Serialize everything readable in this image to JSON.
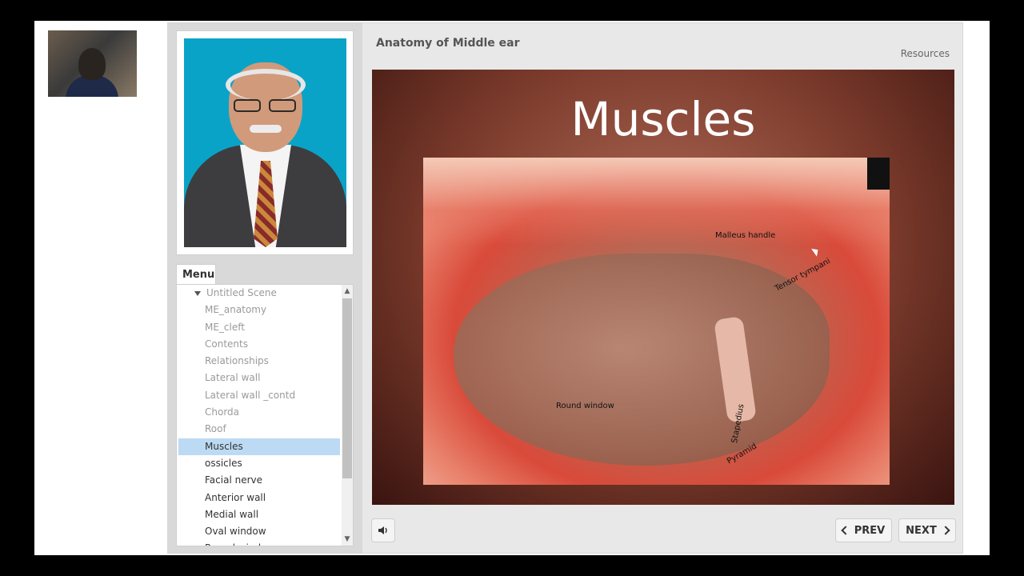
{
  "lesson": {
    "title": "Anatomy of Middle ear",
    "resources_label": "Resources"
  },
  "menu": {
    "tab_label": "Menu",
    "scene_label": "Untitled Scene",
    "items": [
      {
        "label": "ME_anatomy",
        "state": "visited"
      },
      {
        "label": "ME_cleft",
        "state": "visited"
      },
      {
        "label": "Contents",
        "state": "visited"
      },
      {
        "label": "Relationships",
        "state": "visited"
      },
      {
        "label": "Lateral wall",
        "state": "visited"
      },
      {
        "label": "Lateral wall _contd",
        "state": "visited"
      },
      {
        "label": "Chorda",
        "state": "visited"
      },
      {
        "label": "Roof",
        "state": "visited"
      },
      {
        "label": "Muscles",
        "state": "selected"
      },
      {
        "label": "ossicles",
        "state": "unvisited"
      },
      {
        "label": "Facial nerve",
        "state": "unvisited"
      },
      {
        "label": "Anterior wall",
        "state": "unvisited"
      },
      {
        "label": "Medial wall",
        "state": "unvisited"
      },
      {
        "label": "Oval window",
        "state": "unvisited"
      },
      {
        "label": "Round window",
        "state": "unvisited"
      }
    ]
  },
  "slide": {
    "title": "Muscles",
    "labels": {
      "malleus": "Malleus handle",
      "tensor": "Tensor tympani",
      "round_window": "Round window",
      "stapedius": "Stapedius",
      "pyramid": "Pyramid"
    }
  },
  "controls": {
    "prev_label": "PREV",
    "next_label": "NEXT",
    "audio_icon": "speaker-icon"
  },
  "colors": {
    "selected_item": "#bcdaf3",
    "photo_background": "#0aa3c8"
  }
}
